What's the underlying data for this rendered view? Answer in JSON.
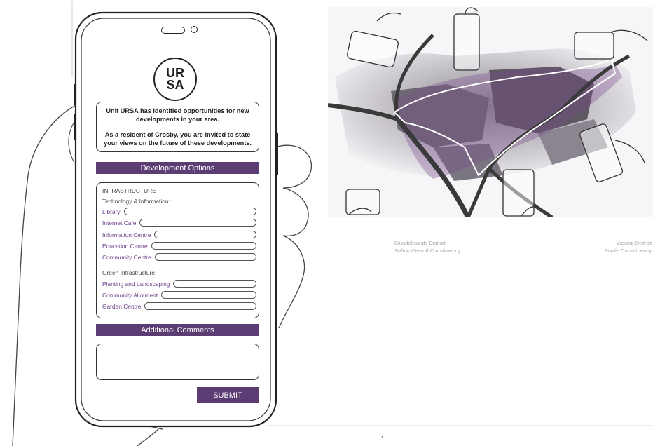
{
  "logo": {
    "line1": "UR",
    "line2": "SA"
  },
  "intro": {
    "line1": "Unit URSA has identified opportunities for new developments in your area.",
    "line2": "As a resident of Crosby, you are invited to state your views on the future of these developments."
  },
  "development_options_heading": "Development Options",
  "infrastructure": {
    "heading": "INFRASTRUCTURE",
    "tech_heading": "Technology & Information:",
    "tech_items": [
      "Library",
      "Internet Cafe",
      "Information Centre",
      "Education Centre",
      "Community Centre"
    ],
    "green_heading": "Green Infrastructure:",
    "green_items": [
      "Planting and Landscaping",
      "Community Allotment",
      "Garden Centre"
    ]
  },
  "additional_comments_heading": "Additional Comments",
  "submit_label": "SUBMIT",
  "map_captions": {
    "left_line1": "Blundellsands District",
    "left_line2": "Sefton Central Constituency",
    "right_line1": "Victoria District",
    "right_line2": "Bootle Constituency"
  },
  "colors": {
    "accent": "#5c3d73",
    "label_purple": "#6b3f86",
    "route": "#7a4a8e"
  }
}
